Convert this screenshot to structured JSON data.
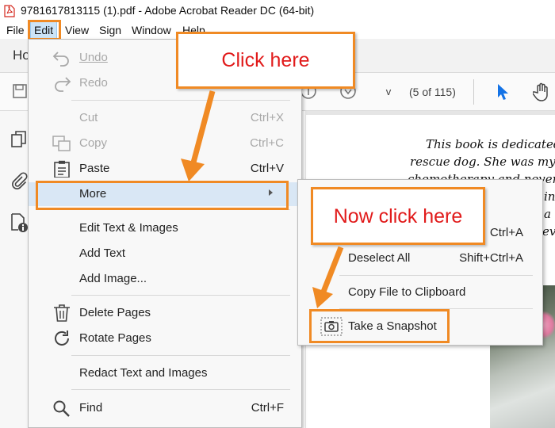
{
  "window": {
    "title": "9781617813115 (1).pdf - Adobe Acrobat Reader DC (64-bit)"
  },
  "menubar": [
    "File",
    "Edit",
    "View",
    "Sign",
    "Window",
    "Help"
  ],
  "tabs": {
    "home_partial": "Ho"
  },
  "toolbar": {
    "page_number": "v",
    "page_count": "(5 of 115)"
  },
  "edit_menu": {
    "undo": "Undo",
    "redo": "Redo",
    "cut": "Cut",
    "cut_shortcut": "Ctrl+X",
    "copy": "Copy",
    "copy_shortcut": "Ctrl+C",
    "paste": "Paste",
    "paste_shortcut": "Ctrl+V",
    "more": "More",
    "edit_text_images": "Edit Text & Images",
    "add_text": "Add Text",
    "add_image": "Add Image...",
    "delete_pages": "Delete Pages",
    "rotate_pages": "Rotate Pages",
    "redact": "Redact Text and Images",
    "find": "Find",
    "find_shortcut": "Ctrl+F"
  },
  "submenu": {
    "select_all_shortcut": "Ctrl+A",
    "deselect_all": "Deselect All",
    "deselect_all_shortcut": "Shift+Ctrl+A",
    "copy_file": "Copy File to Clipboard",
    "snapshot": "Take a Snapshot"
  },
  "document": {
    "line1": "This book is dedicated t",
    "line2": "rescue dog. She was my co",
    "line3": "chemotherapy and never lo",
    "line4": "in",
    "line5": "a",
    "line6": "ev"
  },
  "callouts": {
    "first": "Click here",
    "second": "Now click here"
  },
  "colors": {
    "callout_border": "#f08a24",
    "callout_text": "#e11b1b",
    "highlight": "#d9e7f5"
  }
}
